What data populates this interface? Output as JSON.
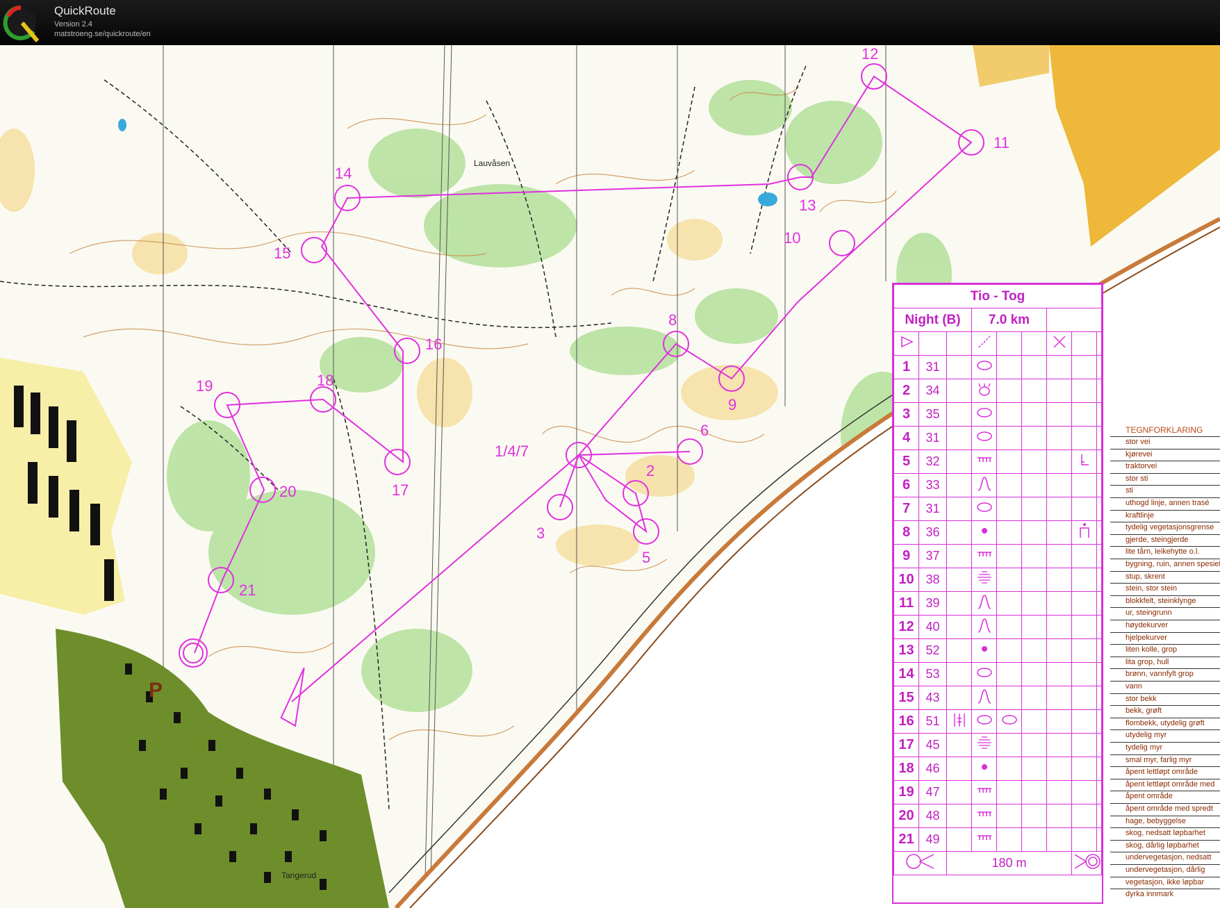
{
  "window": {
    "title": "QuickRoute",
    "version": "Version 2.4",
    "url": "matstroeng.se/quickroute/en"
  },
  "map": {
    "places": [
      "Lauvåsen",
      "Tangerud"
    ],
    "parking_symbol": "P",
    "control_labels": [
      "1/4/7",
      "2",
      "3",
      "5",
      "6",
      "8",
      "9",
      "10",
      "11",
      "12",
      "13",
      "14",
      "15",
      "16",
      "17",
      "18",
      "19",
      "20",
      "21"
    ],
    "overprint_color": "#e030e0"
  },
  "description_sheet": {
    "title": "Tio - Tog",
    "class": "Night (B)",
    "length": "7.0 km",
    "rows": [
      {
        "n": "1",
        "code": "31",
        "sym": "ellipse"
      },
      {
        "n": "2",
        "code": "34",
        "sym": "root"
      },
      {
        "n": "3",
        "code": "35",
        "sym": "ellipse"
      },
      {
        "n": "4",
        "code": "31",
        "sym": "ellipse"
      },
      {
        "n": "5",
        "code": "32",
        "sym": "fence",
        "extra": "corner"
      },
      {
        "n": "6",
        "code": "33",
        "sym": "knoll"
      },
      {
        "n": "7",
        "code": "31",
        "sym": "ellipse"
      },
      {
        "n": "8",
        "code": "36",
        "sym": "dot",
        "extra": "gate"
      },
      {
        "n": "9",
        "code": "37",
        "sym": "fence"
      },
      {
        "n": "10",
        "code": "38",
        "sym": "lines"
      },
      {
        "n": "11",
        "code": "39",
        "sym": "knoll"
      },
      {
        "n": "12",
        "code": "40",
        "sym": "knoll"
      },
      {
        "n": "13",
        "code": "52",
        "sym": "dot"
      },
      {
        "n": "14",
        "code": "53",
        "sym": "ellipse"
      },
      {
        "n": "15",
        "code": "43",
        "sym": "knoll"
      },
      {
        "n": "16",
        "code": "51",
        "sym": "ellipse",
        "pre": "between",
        "extra2": "ellipse"
      },
      {
        "n": "17",
        "code": "45",
        "sym": "lines"
      },
      {
        "n": "18",
        "code": "46",
        "sym": "dot"
      },
      {
        "n": "19",
        "code": "47",
        "sym": "fence"
      },
      {
        "n": "20",
        "code": "48",
        "sym": "fence"
      },
      {
        "n": "21",
        "code": "49",
        "sym": "fence"
      }
    ],
    "finish_distance": "180 m"
  },
  "legend": {
    "title": "TEGNFORKLARING",
    "items": [
      "stor vei",
      "kjørevei",
      "traktorvei",
      "stor sti",
      "sti",
      "uthogd linje, annen trasé",
      "kraftlinje",
      "tydelig vegetasjonsgrense",
      "gjerde, steingjerde",
      "lite tårn, leikehytte o.l.",
      "bygning, ruin, annen spesiell",
      "stup, skrent",
      "stein, stor stein",
      "blokkfelt, steinklynge",
      "ur, steingrunn",
      "høydekurver",
      "hjelpekurver",
      "liten kolle, grop",
      "lita grop, hull",
      "brønn, vannfylt grop",
      "vann",
      "stor bekk",
      "bekk, grøft",
      "flombekk, utydelig grøft",
      "utydelig myr",
      "tydelig myr",
      "smal myr, farlig myr",
      "åpent lettløpt område",
      "åpent lettløpt område med",
      "åpent område",
      "åpent område med spredt",
      "hage, bebyggelse",
      "skog, nedsatt løpbarhet",
      "skog, dårlig løpbarhet",
      "undervegetasjon, nedsatt",
      "undervegetasjon, dårlig",
      "vegetasjon, ikke løpbar",
      "dyrka innmark"
    ]
  }
}
